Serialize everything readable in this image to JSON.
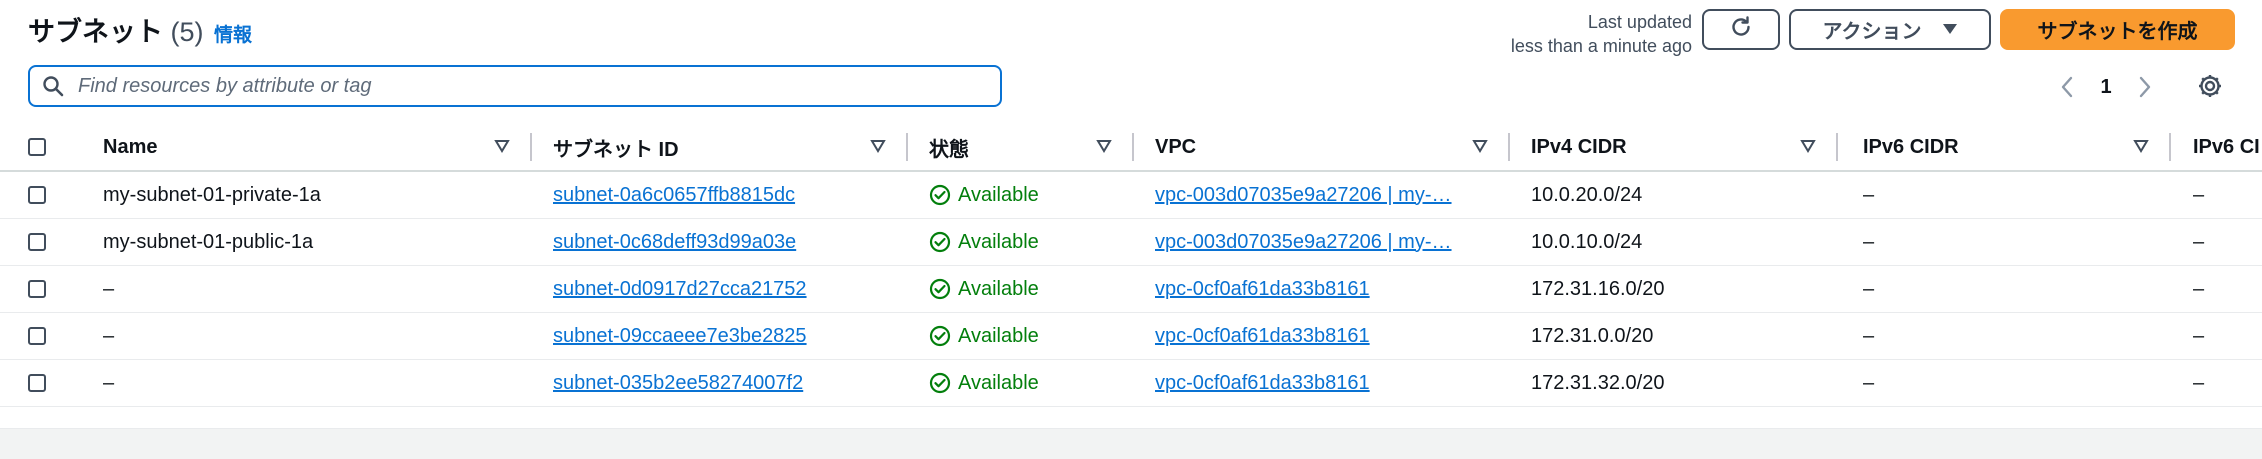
{
  "header": {
    "title": "サブネット",
    "count": "(5)",
    "info_label": "情報",
    "last_updated_line1": "Last updated",
    "last_updated_line2": "less than a minute ago",
    "actions_label": "アクション",
    "create_label": "サブネットを作成"
  },
  "search": {
    "placeholder": "Find resources by attribute or tag",
    "value": ""
  },
  "pagination": {
    "current_page": "1"
  },
  "columns": [
    "Name",
    "サブネット ID",
    "状態",
    "VPC",
    "IPv4 CIDR",
    "IPv6 CIDR",
    "IPv6 CI"
  ],
  "rows": [
    {
      "name": "my-subnet-01-private-1a",
      "subnet_id": "subnet-0a6c0657ffb8815dc",
      "state": "Available",
      "vpc": "vpc-003d07035e9a27206 | my-…",
      "ipv4": "10.0.20.0/24",
      "ipv6": "–",
      "ipv6b": "–"
    },
    {
      "name": "my-subnet-01-public-1a",
      "subnet_id": "subnet-0c68deff93d99a03e",
      "state": "Available",
      "vpc": "vpc-003d07035e9a27206 | my-…",
      "ipv4": "10.0.10.0/24",
      "ipv6": "–",
      "ipv6b": "–"
    },
    {
      "name": "–",
      "subnet_id": "subnet-0d0917d27cca21752",
      "state": "Available",
      "vpc": "vpc-0cf0af61da33b8161",
      "ipv4": "172.31.16.0/20",
      "ipv6": "–",
      "ipv6b": "–"
    },
    {
      "name": "–",
      "subnet_id": "subnet-09ccaeee7e3be2825",
      "state": "Available",
      "vpc": "vpc-0cf0af61da33b8161",
      "ipv4": "172.31.0.0/20",
      "ipv6": "–",
      "ipv6b": "–"
    },
    {
      "name": "–",
      "subnet_id": "subnet-035b2ee58274007f2",
      "state": "Available",
      "vpc": "vpc-0cf0af61da33b8161",
      "ipv4": "172.31.32.0/20",
      "ipv6": "–",
      "ipv6b": "–"
    }
  ],
  "icons": {
    "search": "search-icon",
    "refresh": "refresh-icon",
    "actions_caret": "caret-down-icon",
    "prev": "chevron-left-icon",
    "next": "chevron-right-icon",
    "settings": "gear-icon",
    "sort": "sort-caret-icon",
    "status": "check-circle-icon"
  },
  "colors": {
    "link": "#0972d3",
    "status_ok": "#037f0c",
    "primary_button": "#f99a2f",
    "text": "#0f141a"
  }
}
